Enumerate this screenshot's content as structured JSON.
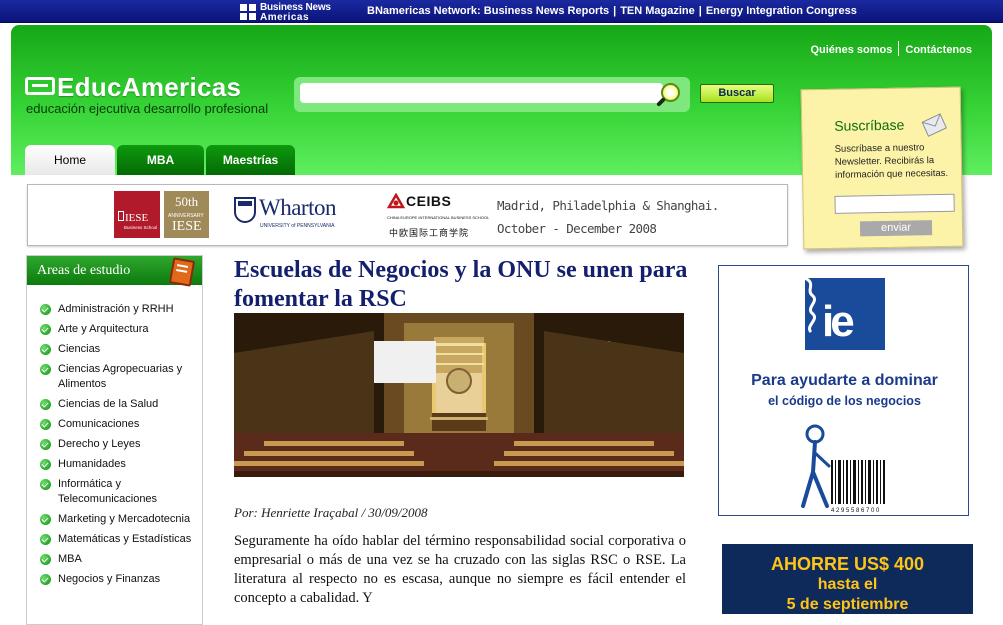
{
  "topbar": {
    "logo_line1": "Business News",
    "logo_line2": "Americas",
    "network_label": "BNamericas Network:",
    "network_links": [
      "Business News Reports",
      "TEN Magazine",
      "Energy Integration Congress"
    ],
    "separator": "|"
  },
  "header": {
    "links": [
      "Quiénes somos",
      "Contáctenos"
    ],
    "logo_text": "EducAmericas",
    "tagline": "educación ejecutiva desarrollo profesional",
    "search_placeholder": "",
    "search_button": "Buscar",
    "tabs": [
      "Home",
      "MBA",
      "Maestrías"
    ],
    "active_tab": "Home"
  },
  "newsletter": {
    "title": "Suscríbase",
    "text": "Suscríbase a nuestro Newsletter. Recibirás la información que necesitas.",
    "button": "enviar"
  },
  "banner": {
    "iese_text": "IESE",
    "iese_sub": "Business School",
    "anniversary": "50th",
    "anniversary_label": "ANNIVERSARY",
    "wharton": "Wharton",
    "wharton_sub": "UNIVERSITY of PENNSYLVANIA",
    "ceibs": "CEIBS",
    "ceibs_sub": "CHINA EUROPE INTERNATIONAL BUSINESS SCHOOL",
    "ceibs_cn": "中欧国际工商学院",
    "line1": "Madrid, Philadelphia & Shanghai.",
    "line2": "October - December 2008"
  },
  "sidebar": {
    "title": "Areas de estudio",
    "items": [
      "Administración y RRHH",
      "Arte y Arquitectura",
      "Ciencias",
      "Ciencias Agropecuarias y Alimentos",
      "Ciencias de la Salud",
      "Comunicaciones",
      "Derecho y Leyes",
      "Humanidades",
      "Informática y Telecomunicaciones",
      "Marketing y Mercadotecnia",
      "Matemáticas y Estadísticas",
      "MBA",
      "Negocios y Finanzas"
    ]
  },
  "article": {
    "headline": "Escuelas de Negocios y la ONU se unen para fomentar la RSC",
    "byline": "Por: Henriette Iraçabal / 30/09/2008",
    "body": "Seguramente ha oído hablar del término responsabilidad social corporativa o empresarial o más de una vez se ha cruzado con las siglas RSC o RSE. La literatura al respecto no es escasa, aunque no siempre es fácil entender el concepto a cabalidad. Y"
  },
  "ads": {
    "ie_logo": "ie",
    "ie_line1": "Para ayudarte a dominar",
    "ie_line2": "el código de los negocios",
    "barcode_number": "4 2 9 5 5 8 6 7 0 0",
    "ad2_line1": "AHORRE  US$ 400",
    "ad2_line2": "hasta el",
    "ad2_line3": "5 de septiembre"
  },
  "colors": {
    "green_dark": "#0d7a0d",
    "green_light": "#5fee5f",
    "navy": "#14206e",
    "ie_blue": "#1a4a9a",
    "ad_yellow": "#ffc418"
  }
}
